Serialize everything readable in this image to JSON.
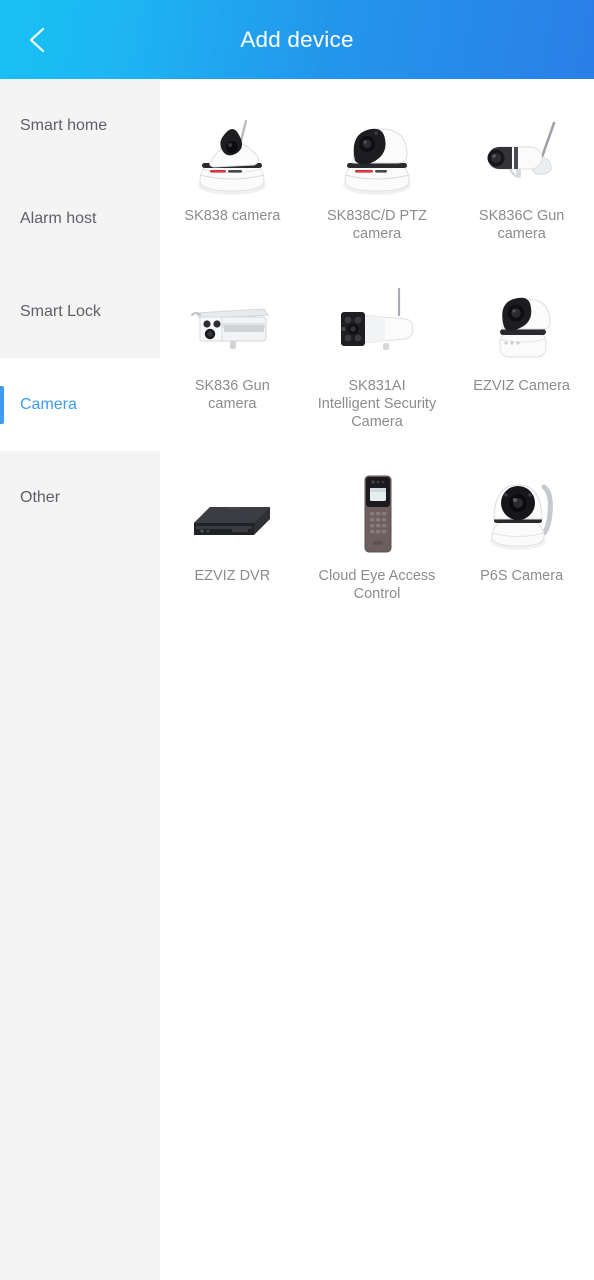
{
  "header": {
    "title": "Add device",
    "back_icon": "chevron-left-icon",
    "gradient_start": "#18c0f5",
    "gradient_end": "#2a7fe6",
    "title_color": "#ffffff"
  },
  "sidebar": {
    "background": "#f4f4f5",
    "active_color": "#3d9bf0",
    "inactive_color": "#5d6166",
    "items": [
      {
        "label": "Smart home",
        "active": false
      },
      {
        "label": "Alarm host",
        "active": false
      },
      {
        "label": "Smart Lock",
        "active": false
      },
      {
        "label": "Camera",
        "active": true
      },
      {
        "label": "Other",
        "active": false
      }
    ]
  },
  "content": {
    "label_color": "#8a8c8f",
    "devices": [
      {
        "label": "SK838 camera",
        "icon": "ptz-dome-camera-icon"
      },
      {
        "label": "SK838C/D PTZ camera",
        "icon": "ptz-dome-camera-black-face-icon"
      },
      {
        "label": "SK836C Gun camera",
        "icon": "bullet-camera-antenna-icon"
      },
      {
        "label": "SK836 Gun camera",
        "icon": "box-bullet-camera-icon"
      },
      {
        "label": "SK831AI Intelligent Security Camera",
        "icon": "ir-bullet-camera-icon"
      },
      {
        "label": "EZVIZ Camera",
        "icon": "ezviz-dome-camera-icon"
      },
      {
        "label": "EZVIZ DVR",
        "icon": "dvr-box-icon"
      },
      {
        "label": "Cloud Eye Access Control",
        "icon": "access-control-panel-icon"
      },
      {
        "label": "P6S Camera",
        "icon": "p6s-dome-camera-icon"
      }
    ]
  }
}
